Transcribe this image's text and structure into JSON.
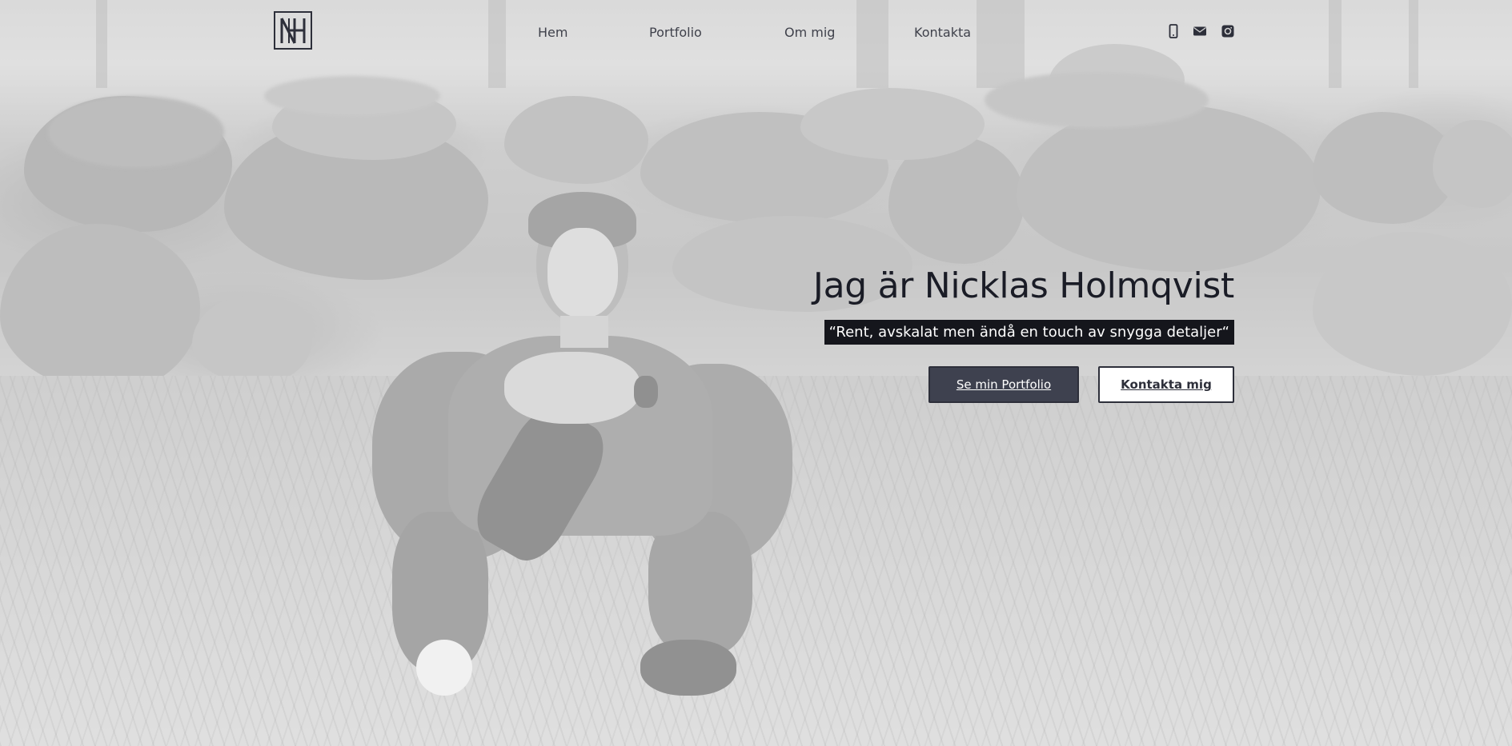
{
  "brand": {
    "logo_icon": "nh-monogram-logo"
  },
  "nav": {
    "items": [
      {
        "label": "Hem"
      },
      {
        "label": "Portfolio"
      },
      {
        "label": "Om mig"
      },
      {
        "label": "Kontakta"
      }
    ]
  },
  "social": [
    {
      "icon": "phone-icon"
    },
    {
      "icon": "mail-icon"
    },
    {
      "icon": "instagram-icon"
    }
  ],
  "hero": {
    "title": "Jag är Nicklas Holmqvist",
    "tagline": "“Rent, avskalat men ändå en touch av snygga detaljer“",
    "primary_button": "Se min Portfolio",
    "secondary_button": "Kontakta mig"
  },
  "colors": {
    "text_dark": "#1a1c26",
    "nav_text": "#3f414b",
    "button_primary_bg": "#3e414f",
    "tagline_bg": "#15161c"
  }
}
